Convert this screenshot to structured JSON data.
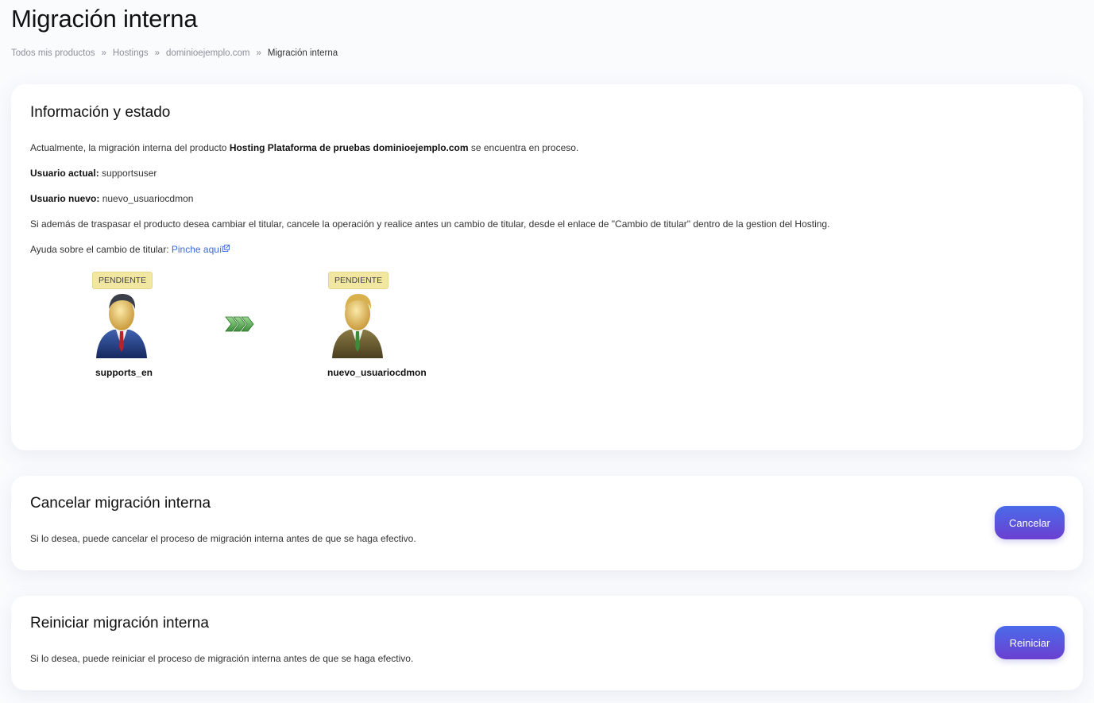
{
  "page": {
    "title": "Migración interna"
  },
  "breadcrumb": {
    "items": [
      "Todos mis productos",
      "Hostings",
      "dominioejemplo.com"
    ],
    "separator": "»",
    "current": "Migración interna"
  },
  "info": {
    "title": "Información y estado",
    "status_prefix": "Actualmente, la migración interna del producto ",
    "product": "Hosting Plataforma de pruebas dominioejemplo.com",
    "status_suffix": " se encuentra en proceso.",
    "current_user_label": "Usuario actual:",
    "current_user_value": " supportsuser",
    "new_user_label": "Usuario nuevo:",
    "new_user_value": " nuevo_usuariocdmon",
    "notice": "Si además de traspasar el producto desea cambiar el titular, cancele la operación y realice antes un cambio de titular, desde el enlace de \"Cambio de titular\" dentro de la gestion del Hosting.",
    "help_prefix": "Ayuda sobre el cambio de titular: ",
    "help_link": "Pinche aquí",
    "source": {
      "badge": "PENDIENTE",
      "name": "supports_en",
      "icon": "user-blue-suit-icon"
    },
    "target": {
      "badge": "PENDIENTE",
      "name": "nuevo_usuariocdmon",
      "icon": "user-olive-suit-icon"
    },
    "transfer_icon": "triple-chevron-right-icon"
  },
  "cancel": {
    "title": "Cancelar migración interna",
    "description": "Si lo desea, puede cancelar el proceso de migración interna antes de que se haga efectivo.",
    "button": "Cancelar"
  },
  "restart": {
    "title": "Reiniciar migración interna",
    "description": "Si lo desea, puede reiniciar el proceso de migración interna antes de que se haga efectivo.",
    "button": "Reiniciar"
  },
  "colors": {
    "badge_bg": "#f1e7a1",
    "link": "#3a6ad8",
    "button_start": "#4a6bea",
    "button_end": "#6b3fd0"
  }
}
